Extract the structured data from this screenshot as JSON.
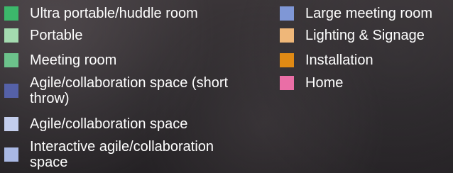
{
  "chart_data": {
    "type": "legend",
    "legend": {
      "left_column": [
        {
          "label": "Ultra portable/huddle room",
          "color": "#3cb86b"
        },
        {
          "label": "Portable",
          "color": "#a4dbb0"
        },
        {
          "label": "Meeting room",
          "color": "#6cc28b"
        },
        {
          "label": "Agile/collaboration space (short throw)",
          "color": "#5561a8"
        },
        {
          "label": "Agile/collaboration space",
          "color": "#c3cdec"
        },
        {
          "label": "Interactive agile/collaboration space",
          "color": "#a9b8e4"
        }
      ],
      "right_column": [
        {
          "label": "Large meeting room",
          "color": "#7f97d6"
        },
        {
          "label": "Lighting & Signage",
          "color": "#efb779"
        },
        {
          "label": "Installation",
          "color": "#e08a14"
        },
        {
          "label": "Home",
          "color": "#ea6ea6"
        }
      ]
    }
  }
}
